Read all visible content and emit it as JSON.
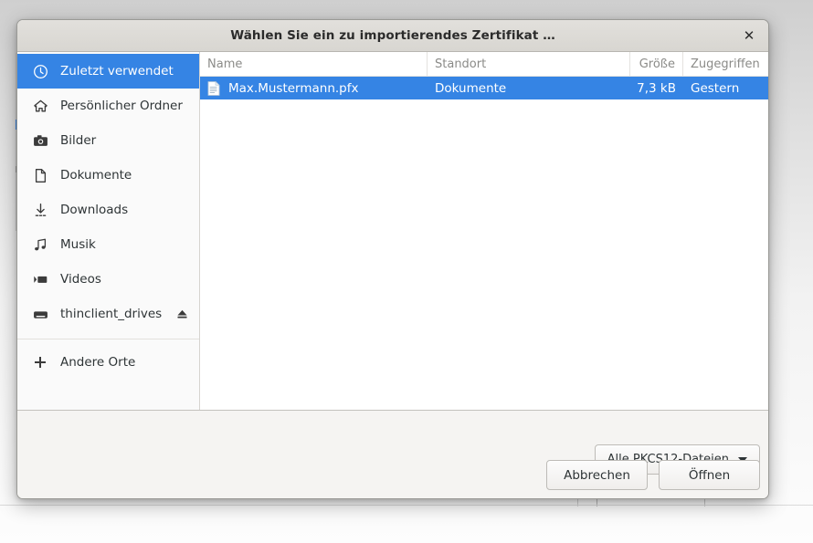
{
  "dialog": {
    "title": "Wählen Sie ein zu importierendes Zertifikat …",
    "close_label": "✕"
  },
  "sidebar": {
    "items": [
      {
        "label": "Zuletzt verwendet",
        "icon": "clock-icon",
        "selected": true,
        "eject": false
      },
      {
        "label": "Persönlicher Ordner",
        "icon": "home-icon",
        "selected": false,
        "eject": false
      },
      {
        "label": "Bilder",
        "icon": "camera-icon",
        "selected": false,
        "eject": false
      },
      {
        "label": "Dokumente",
        "icon": "document-icon",
        "selected": false,
        "eject": false
      },
      {
        "label": "Downloads",
        "icon": "download-icon",
        "selected": false,
        "eject": false
      },
      {
        "label": "Musik",
        "icon": "music-icon",
        "selected": false,
        "eject": false
      },
      {
        "label": "Videos",
        "icon": "video-icon",
        "selected": false,
        "eject": false
      },
      {
        "label": "thinclient_drives",
        "icon": "drive-icon",
        "selected": false,
        "eject": true
      }
    ],
    "other_places": {
      "label": "Andere Orte",
      "icon": "plus-icon"
    }
  },
  "file_list": {
    "columns": [
      {
        "label": "Name",
        "key": "name"
      },
      {
        "label": "Standort",
        "key": "location"
      },
      {
        "label": "Größe",
        "key": "size"
      },
      {
        "label": "Zugegriffen",
        "key": "accessed"
      }
    ],
    "rows": [
      {
        "name": "Max.Mustermann.pfx",
        "location": "Dokumente",
        "size": "7,3 kB",
        "accessed": "Gestern",
        "icon": "file-icon",
        "selected": true
      }
    ]
  },
  "footer": {
    "filter_label": "Alle PKCS12-Dateien",
    "cancel_label": "Abbrechen",
    "open_label": "Öffnen"
  },
  "colors": {
    "selection_blue": "#3584e4",
    "titlebar": "#dcdad5",
    "sidebar_bg": "#fafafa",
    "footer_bg": "#f5f4f2"
  }
}
